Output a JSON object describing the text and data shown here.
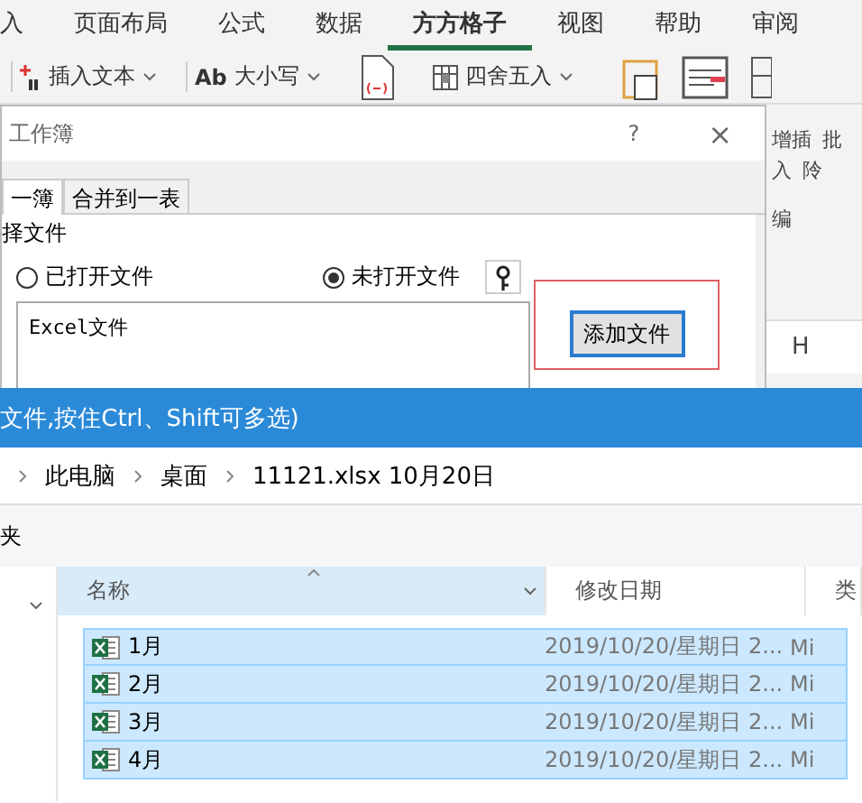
{
  "ribbon": {
    "tabs": [
      {
        "label": "入",
        "selected": false
      },
      {
        "label": "页面布局",
        "selected": false
      },
      {
        "label": "公式",
        "selected": false
      },
      {
        "label": "数据",
        "selected": false
      },
      {
        "label": "方方格子",
        "selected": true
      },
      {
        "label": "视图",
        "selected": false
      },
      {
        "label": "帮助",
        "selected": false
      },
      {
        "label": "审阅",
        "selected": false
      }
    ],
    "tools": [
      {
        "kind": "insert",
        "label": "插入文本"
      },
      {
        "kind": "case",
        "prefix": "Ab",
        "label": "大小写"
      },
      {
        "kind": "doc"
      },
      {
        "kind": "round",
        "label": "四舍五入"
      }
    ],
    "side_labels": [
      "增插",
      "批",
      "入",
      "阾",
      "编"
    ]
  },
  "sheet": {
    "column_header": "H"
  },
  "merge_dialog": {
    "title": "工作簿",
    "help": "?",
    "close": "×",
    "tabs": [
      {
        "label": "一簿",
        "selected": true
      },
      {
        "label": "合并到一表",
        "selected": false
      }
    ],
    "group_label": "择文件",
    "radios": [
      {
        "label": "已打开文件",
        "selected": false
      },
      {
        "label": "未打开文件",
        "selected": true
      }
    ],
    "file_list": {
      "header": "Excel文件"
    },
    "add_button": {
      "label": "添加文件",
      "highlighted": true
    }
  },
  "open_dialog": {
    "title": "文件,按住Ctrl、Shift可多选)",
    "breadcrumb": [
      "此电脑",
      "桌面",
      "11121.xlsx 10月20日"
    ],
    "toolbar_text": "夹",
    "columns": [
      "名称",
      "修改日期",
      "类"
    ],
    "rows": [
      {
        "name": "1月",
        "modified": "2019/10/20/星期日 2...",
        "type": "Mi",
        "selected": true
      },
      {
        "name": "2月",
        "modified": "2019/10/20/星期日 2...",
        "type": "Mi",
        "selected": true
      },
      {
        "name": "3月",
        "modified": "2019/10/20/星期日 2...",
        "type": "Mi",
        "selected": true
      },
      {
        "name": "4月",
        "modified": "2019/10/20/星期日 2...",
        "type": "Mi",
        "selected": true
      }
    ]
  }
}
